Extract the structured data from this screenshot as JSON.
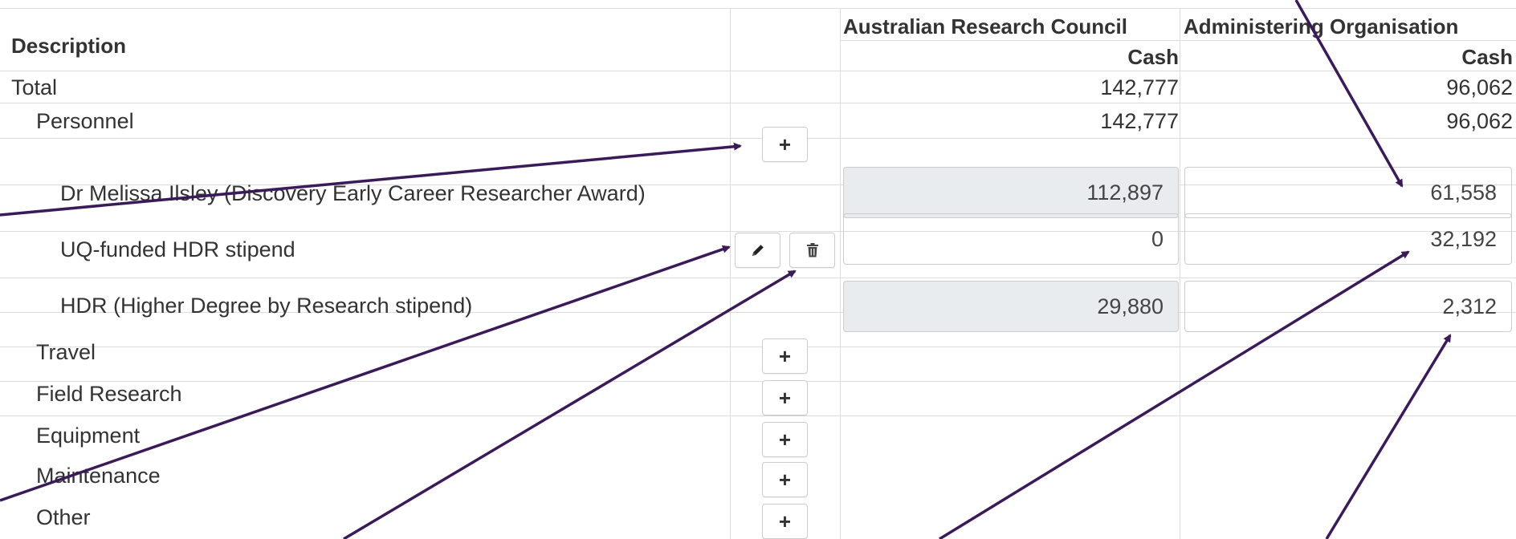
{
  "headers": {
    "description": "Description",
    "arc": "Australian Research Council",
    "admin": "Administering Organisation",
    "arc_cash": "Cash",
    "admin_cash": "Cash"
  },
  "rows": {
    "total": {
      "label": "Total",
      "arc": "142,777",
      "admin": "96,062"
    },
    "personnel": {
      "label": "Personnel",
      "arc": "142,777",
      "admin": "96,062"
    },
    "melissa": {
      "label": "Dr Melissa Ilsley (Discovery Early Career Researcher Award)",
      "arc": "112,897",
      "admin": "61,558"
    },
    "uq": {
      "label": "UQ-funded HDR stipend",
      "arc": "0",
      "admin": "32,192"
    },
    "hdr": {
      "label": "HDR (Higher Degree by Research stipend)",
      "arc": "29,880",
      "admin": "2,312"
    },
    "travel": {
      "label": "Travel"
    },
    "field": {
      "label": "Field Research"
    },
    "equipment": {
      "label": "Equipment"
    },
    "maintenance": {
      "label": "Maintenance"
    },
    "other": {
      "label": "Other"
    }
  },
  "icons": {
    "add": "plus-icon",
    "edit": "pencil-icon",
    "delete": "trash-icon"
  },
  "colors": {
    "arrow": "#3b1a5a",
    "readonly_fill": "#e9ecef",
    "border": "#dddddd"
  }
}
